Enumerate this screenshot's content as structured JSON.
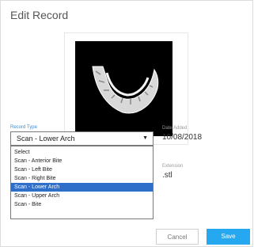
{
  "dialog": {
    "title": "Edit Record"
  },
  "preview": {
    "icon": "dental-arch-scan-image"
  },
  "record_type": {
    "label": "Record Type",
    "selected_value": "Scan - Lower Arch",
    "options": [
      "Select",
      "Scan - Anterior Bite",
      "Scan - Left Bite",
      "Scan - Right Bite",
      "Scan - Lower Arch",
      "Scan - Upper Arch",
      "Scan - Bite"
    ],
    "highlighted_index": 4
  },
  "date_added": {
    "label": "Date Added",
    "value": "10/08/2018"
  },
  "extension": {
    "label": "Extension",
    "value": ".stl"
  },
  "buttons": {
    "cancel": "Cancel",
    "save": "Save"
  },
  "colors": {
    "accent": "#26a8f0",
    "highlight": "#2f6fc9",
    "label_blue": "#3b8fd6"
  }
}
